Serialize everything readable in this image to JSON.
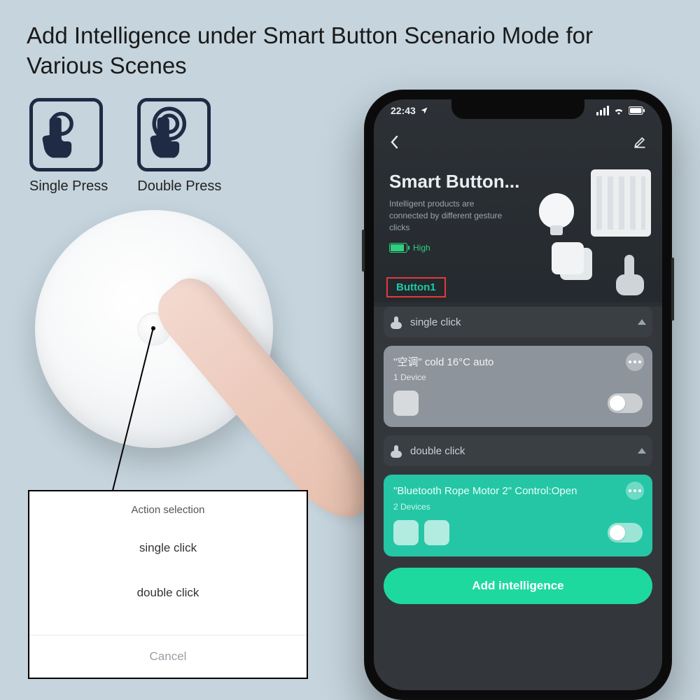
{
  "headline": "Add Intelligence under Smart Button Scenario Mode for Various Scenes",
  "press": {
    "single": "Single Press",
    "double": "Double Press"
  },
  "popup": {
    "title": "Action selection",
    "option1": "single click",
    "option2": "double click",
    "cancel": "Cancel"
  },
  "phone": {
    "status_time": "22:43",
    "header": {
      "title": "Smart Button...",
      "subtitle": "Intelligent products are connected by different gesture clicks",
      "battery_label": "High"
    },
    "tab": "Button1",
    "sections": {
      "single": "single click",
      "double": "double click"
    },
    "card1": {
      "title": "\"空调\" cold 16°C auto",
      "sub": "1 Device"
    },
    "card2": {
      "title": "\"Bluetooth Rope Motor 2\" Control:Open",
      "sub": "2 Devices"
    },
    "add_button": "Add intelligence"
  }
}
